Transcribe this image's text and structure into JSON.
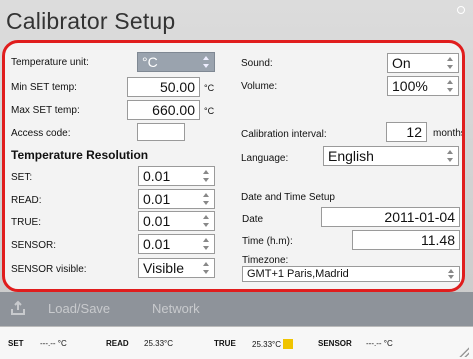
{
  "title": "Calibrator Setup",
  "left": {
    "temperature_unit_label": "Temperature unit:",
    "temperature_unit_value": "°C",
    "min_set_label": "Min SET temp:",
    "min_set_value": "50.00",
    "min_set_unit": "°C",
    "max_set_label": "Max SET temp:",
    "max_set_value": "660.00",
    "max_set_unit": "°C",
    "access_code_label": "Access code:",
    "access_code_value": "",
    "resolution_header": "Temperature Resolution",
    "set_label": "SET:",
    "set_value": "0.01",
    "read_label": "READ:",
    "read_value": "0.01",
    "true_label": "TRUE:",
    "true_value": "0.01",
    "sensor_label": "SENSOR:",
    "sensor_value": "0.01",
    "sensor_visible_label": "SENSOR visible:",
    "sensor_visible_value": "Visible"
  },
  "right": {
    "sound_label": "Sound:",
    "sound_value": "On",
    "volume_label": "Volume:",
    "volume_value": "100%",
    "cal_interval_label": "Calibration interval:",
    "cal_interval_value": "12",
    "cal_interval_unit": "months",
    "language_label": "Language:",
    "language_value": "English",
    "datetime_header": "Date and Time Setup",
    "date_label": "Date",
    "date_value": "2011-01-04",
    "time_label": "Time (h.m):",
    "time_value": "11.48",
    "timezone_label": "Timezone:",
    "timezone_value": "GMT+1 Paris,Madrid"
  },
  "toolbar": {
    "load_save": "Load/Save",
    "network": "Network"
  },
  "status": {
    "set_label": "SET",
    "set_value": "---.-- °C",
    "read_label": "READ",
    "read_value": "25.33°C",
    "true_label": "TRUE",
    "true_value": "25.33°C",
    "sensor_label": "SENSOR",
    "sensor_value": "---.-- °C"
  }
}
